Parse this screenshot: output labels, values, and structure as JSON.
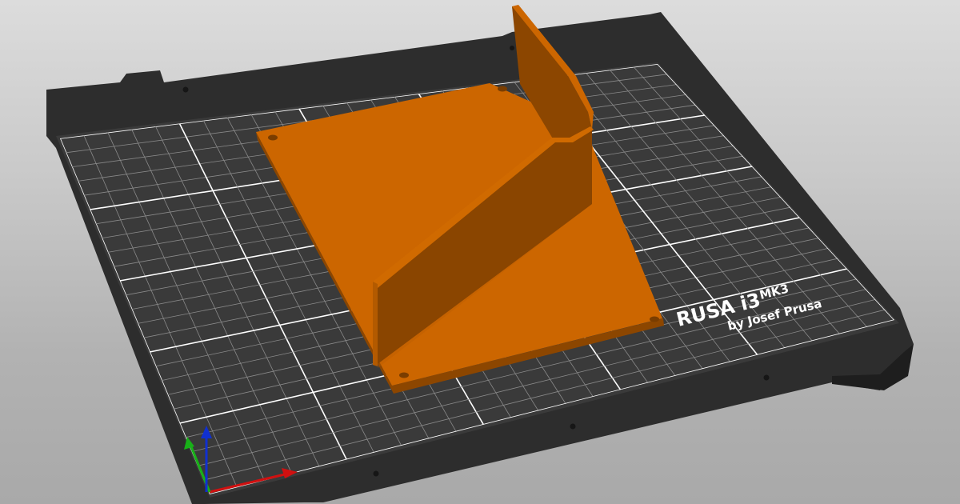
{
  "bed": {
    "brand_text": "RUSA i3",
    "model_text": "MK3",
    "byline_text": "by Josef Prusa"
  },
  "colors": {
    "background_top": "#dcdcdc",
    "background_bottom": "#a9a9a9",
    "bed_frame": "#2f2f2f",
    "bed_surface": "#3a3a3a",
    "grid_major": "#ffffff",
    "grid_minor": "#8a8a8a",
    "part_top": "#cc6600",
    "part_dark": "#8a4500",
    "part_side": "#b35a00",
    "axis_x": "#d01010",
    "axis_y": "#18b018",
    "axis_z": "#1030d0"
  },
  "icons": [
    "x-axis-arrow-icon",
    "y-axis-arrow-icon",
    "z-axis-arrow-icon",
    "mount-hole-icon"
  ]
}
